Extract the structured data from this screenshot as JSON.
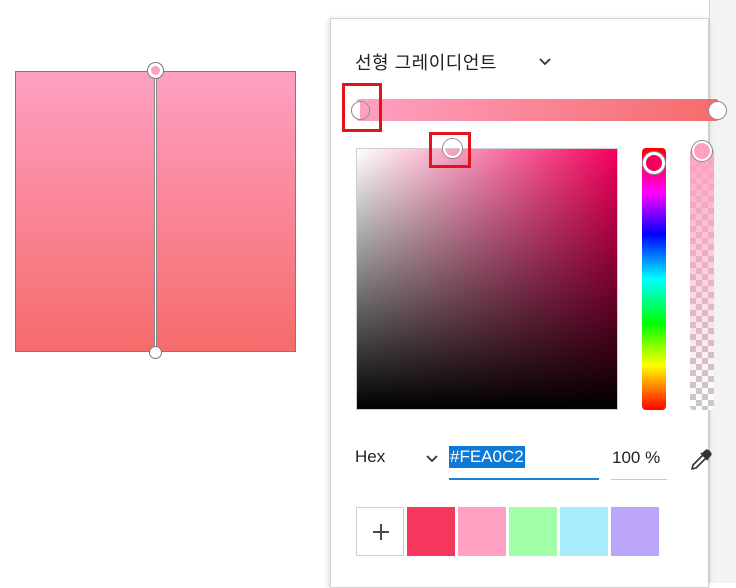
{
  "canvas": {
    "gradient_start_color": "#fea0c2",
    "gradient_end_color": "#f56b6b"
  },
  "panel": {
    "gradient_type_label": "선형 그레이디언트",
    "slider": {
      "start_color": "#fea0c2",
      "end_color": "#f56b6b"
    },
    "picker": {
      "hue_color": "#f5005c",
      "selected_color": "#fea0c2"
    },
    "format_label": "Hex",
    "hex_value": "#FEA0C2",
    "opacity_value": "100 %",
    "eyedropper_icon": "eyedropper-icon",
    "add_swatch_icon": "plus-icon",
    "swatches": [
      "#f5375d",
      "#fea0c2",
      "#a1ffa8",
      "#a6ecfc",
      "#bca6fc"
    ],
    "highlight_color": "#e0141c",
    "accent_color": "#1883d7"
  }
}
